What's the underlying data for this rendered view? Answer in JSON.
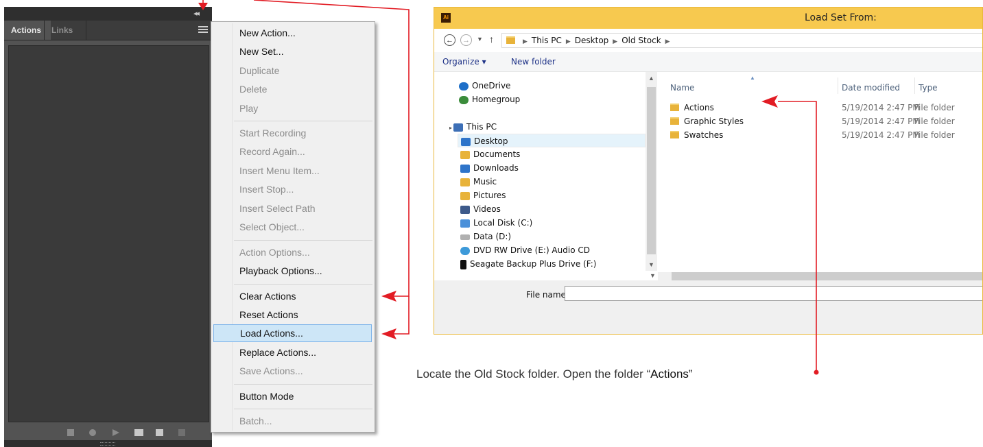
{
  "panel": {
    "tabs": [
      "Actions",
      "Links"
    ],
    "collapse_glyph": "◂◂"
  },
  "menu": {
    "items": [
      {
        "label": "New Action...",
        "enabled": true
      },
      {
        "label": "New Set...",
        "enabled": true
      },
      {
        "label": "Duplicate",
        "enabled": false
      },
      {
        "label": "Delete",
        "enabled": false
      },
      {
        "label": "Play",
        "enabled": false
      },
      {
        "label": "Start Recording",
        "enabled": false
      },
      {
        "label": "Record Again...",
        "enabled": false
      },
      {
        "label": "Insert Menu Item...",
        "enabled": false
      },
      {
        "label": "Insert Stop...",
        "enabled": false
      },
      {
        "label": "Insert Select Path",
        "enabled": false
      },
      {
        "label": "Select Object...",
        "enabled": false
      },
      {
        "label": "Action Options...",
        "enabled": false
      },
      {
        "label": "Playback Options...",
        "enabled": true
      },
      {
        "label": "Clear Actions",
        "enabled": true
      },
      {
        "label": "Reset Actions",
        "enabled": true
      },
      {
        "label": "Load Actions...",
        "enabled": true,
        "highlighted": true
      },
      {
        "label": "Replace Actions...",
        "enabled": true
      },
      {
        "label": "Save Actions...",
        "enabled": false
      },
      {
        "label": "Button Mode",
        "enabled": true
      },
      {
        "label": "Batch...",
        "enabled": false
      }
    ]
  },
  "dialog": {
    "app_badge": "Ai",
    "title": "Load Set From:",
    "breadcrumbs": [
      "This PC",
      "Desktop",
      "Old Stock"
    ],
    "toolbar": {
      "organize": "Organize ▾",
      "new_folder": "New folder"
    },
    "nav": [
      {
        "label": "OneDrive",
        "icon": "cloud-icon",
        "color": "#1e6fc8"
      },
      {
        "label": "Homegroup",
        "icon": "homegroup-icon",
        "color": "#3b8c3b"
      },
      {
        "label": "This PC",
        "icon": "computer-icon",
        "color": "#3d6fb6"
      },
      {
        "label": "Desktop",
        "icon": "desktop-folder-icon",
        "color": "#2e74c9",
        "selected": true
      },
      {
        "label": "Documents",
        "icon": "documents-folder-icon",
        "color": "#e8b33a"
      },
      {
        "label": "Downloads",
        "icon": "downloads-folder-icon",
        "color": "#2e74c9"
      },
      {
        "label": "Music",
        "icon": "music-folder-icon",
        "color": "#e8b33a"
      },
      {
        "label": "Pictures",
        "icon": "pictures-folder-icon",
        "color": "#e8b33a"
      },
      {
        "label": "Videos",
        "icon": "videos-folder-icon",
        "color": "#3d5a8a"
      },
      {
        "label": "Local Disk (C:)",
        "icon": "drive-icon",
        "color": "#4a90d9"
      },
      {
        "label": "Data (D:)",
        "icon": "drive-icon",
        "color": "#b0b0b0"
      },
      {
        "label": "DVD RW Drive (E:) Audio CD",
        "icon": "cd-icon",
        "color": "#3d9ad9"
      },
      {
        "label": "Seagate Backup Plus Drive (F:)",
        "icon": "external-drive-icon",
        "color": "#111111"
      }
    ],
    "columns": {
      "name": "Name",
      "date": "Date modified",
      "type": "Type"
    },
    "files": [
      {
        "name": "Actions",
        "date": "5/19/2014 2:47 PM",
        "type": "File folder"
      },
      {
        "name": "Graphic Styles",
        "date": "5/19/2014 2:47 PM",
        "type": "File folder"
      },
      {
        "name": "Swatches",
        "date": "5/19/2014 2:47 PM",
        "type": "File folder"
      }
    ],
    "file_name_label": "File name:",
    "file_name_value": ""
  },
  "caption": {
    "prefix": "Locate the Old Stock folder. Open the folder “",
    "strong": "Actions",
    "suffix": "”"
  },
  "colors": {
    "annotation": "#e21c24",
    "title_bar": "#f7c94f",
    "menu_highlight": "#cde6f7"
  }
}
